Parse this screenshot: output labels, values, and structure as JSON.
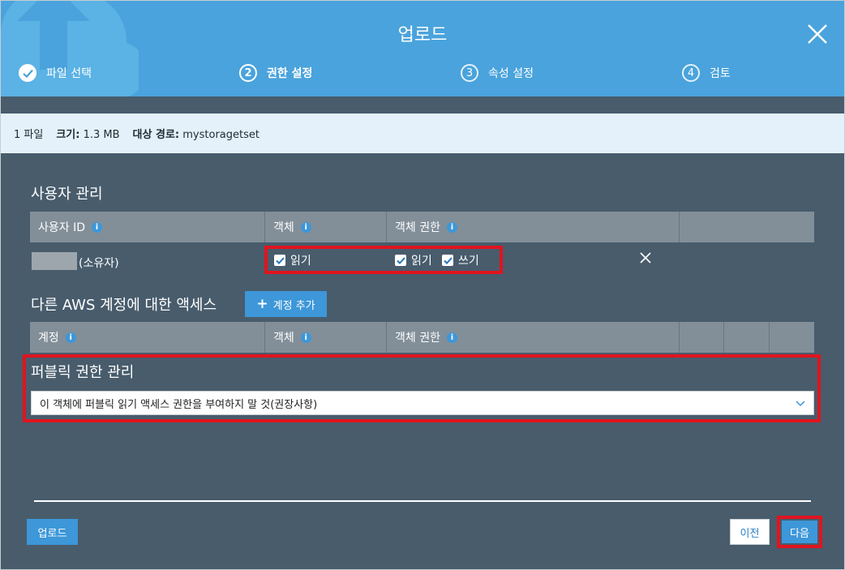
{
  "dialog": {
    "title": "업로드"
  },
  "steps": [
    {
      "number": "",
      "label": "파일 선택",
      "state": "done"
    },
    {
      "number": "2",
      "label": "권한 설정",
      "state": "current"
    },
    {
      "number": "3",
      "label": "속성 설정",
      "state": "pending"
    },
    {
      "number": "4",
      "label": "검토",
      "state": "pending"
    }
  ],
  "infobar": {
    "files": "1 파일",
    "size_label": "크기:",
    "size_value": "1.3 MB",
    "target_label": "대상 경로:",
    "target_value": "mystoragetset"
  },
  "user_management": {
    "title": "사용자 관리",
    "columns": [
      "사용자 ID",
      "객체",
      "객체 권한"
    ],
    "row": {
      "owner_suffix": "(소유자)",
      "object_read": "읽기",
      "perm_read": "읽기",
      "perm_write": "쓰기"
    }
  },
  "other_accounts": {
    "title": "다른 AWS 계정에 대한 액세스",
    "add_button": "계정 추가",
    "columns": [
      "계정",
      "객체",
      "객체 권한"
    ]
  },
  "public_permissions": {
    "title": "퍼블릭 권한 관리",
    "selected": "이 객체에 퍼블릭 읽기 액세스 권한을 부여하지 말 것(권장사항)"
  },
  "footer": {
    "upload_button": "업로드",
    "prev_button": "이전",
    "next_button": "다음"
  },
  "colors": {
    "header": "#4aa3dc",
    "panel": "#485c6c",
    "accent": "#3d97d8",
    "highlight": "#e0141e"
  }
}
